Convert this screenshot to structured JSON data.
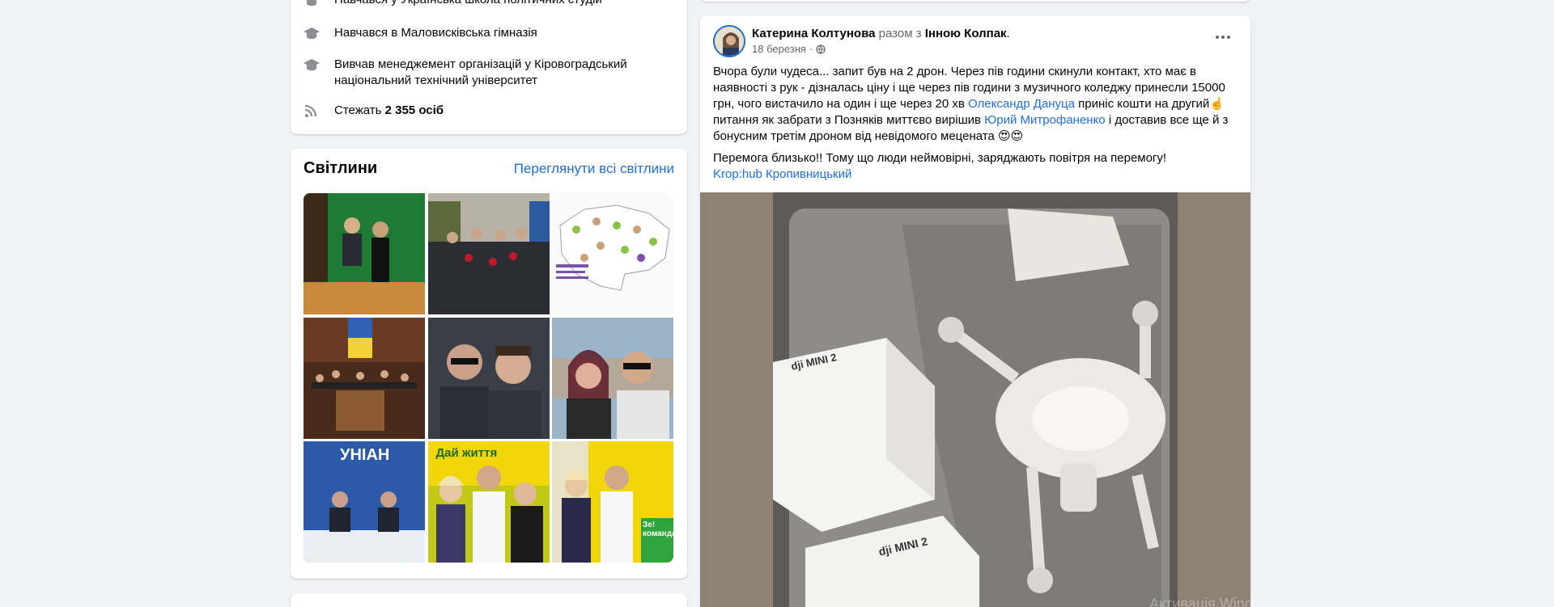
{
  "intro": {
    "items": [
      {
        "icon": "graduation-cap-icon",
        "text": "Навчався у Українська школа політичних студій"
      },
      {
        "icon": "graduation-cap-icon",
        "text": "Навчався в Маловисківська гімназія"
      },
      {
        "icon": "graduation-cap-icon",
        "text": "Вивчав менеджемент організацій у Кіровоградський національний технічний університет"
      },
      {
        "icon": "rss-icon",
        "prefix": "Стежать ",
        "count": "2 355 осіб"
      }
    ]
  },
  "photos": {
    "title": "Світлини",
    "see_all": "Переглянути всі світлини",
    "tiles": [
      {
        "label": ""
      },
      {
        "label": ""
      },
      {
        "label": ""
      },
      {
        "label": ""
      },
      {
        "label": ""
      },
      {
        "label": ""
      },
      {
        "label": "УНІАН"
      },
      {
        "label": "Дай життя"
      },
      {
        "label": "Зе! команда"
      }
    ]
  },
  "post": {
    "author": "Катерина Колтунова",
    "with_text": "разом з",
    "tagged": "Інною Колпак",
    "date": "18 березня",
    "paragraph1_parts": [
      "Вчора були чудеса... запит був на 2 дрон. Через пів години скинули контакт, хто має в наявності з рук - дізналась ціну і ще через пів години з музичного коледжу принесли 15000 грн, чого вистачило на один і ще через 20 хв ",
      "Олександр Дануца",
      " приніс кошти на другий☝️ питання як забрати з Позняків миттєво вирішив ",
      "Юрий Митрофаненко",
      " і доставив все ще й з бонусним третім дроном від невідомого мецената 😍😍"
    ],
    "paragraph2": "Перемога близько!! Тому що люди неймовірні, заряджають повітря на перемогу!",
    "hashtag": "Krop:hub Кропивницький",
    "box_brand": "dji MINI 2"
  },
  "system": {
    "watermark": "Активація Windows"
  },
  "colors": {
    "link": "#216fdb",
    "background": "#f0f2f5",
    "secondary_text": "#65676b"
  }
}
